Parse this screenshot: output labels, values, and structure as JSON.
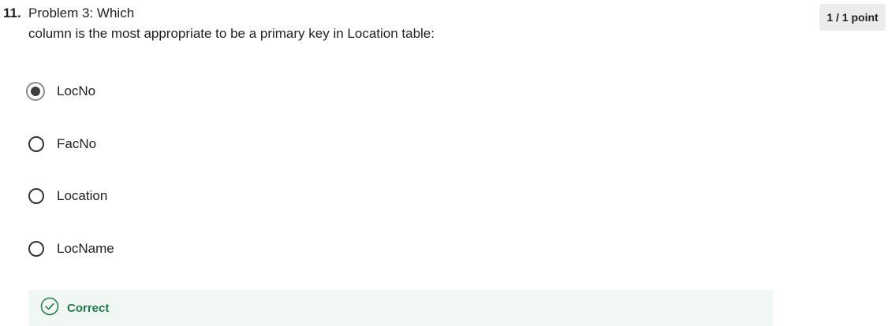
{
  "question": {
    "number": "11.",
    "line1": "Problem 3: Which",
    "line2": "column is the most appropriate to be a primary key in Location table:",
    "points": "1 / 1 point"
  },
  "options": [
    {
      "label": "LocNo",
      "selected": true
    },
    {
      "label": "FacNo",
      "selected": false
    },
    {
      "label": "Location",
      "selected": false
    },
    {
      "label": "LocName",
      "selected": false
    }
  ],
  "feedback": {
    "label": "Correct",
    "icon": "check-circle-icon",
    "color": "#1e7d46",
    "background": "#f1f8f4"
  }
}
